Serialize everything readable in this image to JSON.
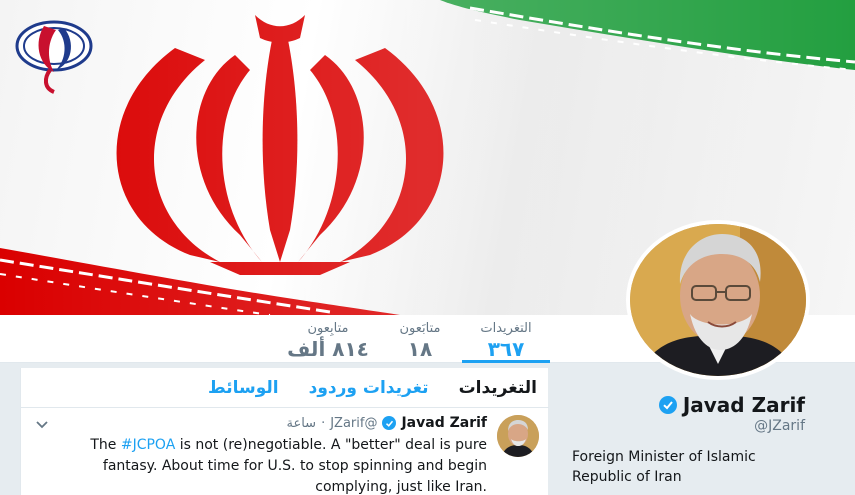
{
  "brand": {
    "logo_icon": "alalam-logo-icon"
  },
  "banner": {
    "image": "iran-flag-emblem"
  },
  "stats": {
    "tweets": {
      "label": "التغريدات",
      "value": "٣٦٧"
    },
    "following": {
      "label": "متابَعون",
      "value": "١٨"
    },
    "followers": {
      "label": "متابِعون",
      "value": "٨١٤ ألف"
    }
  },
  "profile": {
    "name": "Javad Zarif",
    "handle": "@JZarif",
    "bio": "Foreign Minister of Islamic Republic of Iran",
    "verified_icon": "verified-badge-icon"
  },
  "timeline": {
    "tabs": [
      {
        "label": "التغريدات",
        "active": true
      },
      {
        "label": "تغريدات وردود",
        "active": false
      },
      {
        "label": "الوسائط",
        "active": false
      }
    ],
    "tweet": {
      "name": "Javad Zarif",
      "handle": "@JZarif",
      "separator": "·",
      "time": "ساعة",
      "text_before": "The ",
      "hashtag": "#JCPOA",
      "text_after": " is not (re)negotiable. A \"better\" deal is pure fantasy. About time for U.S. to stop spinning and begin complying, just like Iran."
    }
  },
  "colors": {
    "accent": "#1da1f2",
    "flag_green": "#239f40",
    "flag_red": "#da0000"
  }
}
